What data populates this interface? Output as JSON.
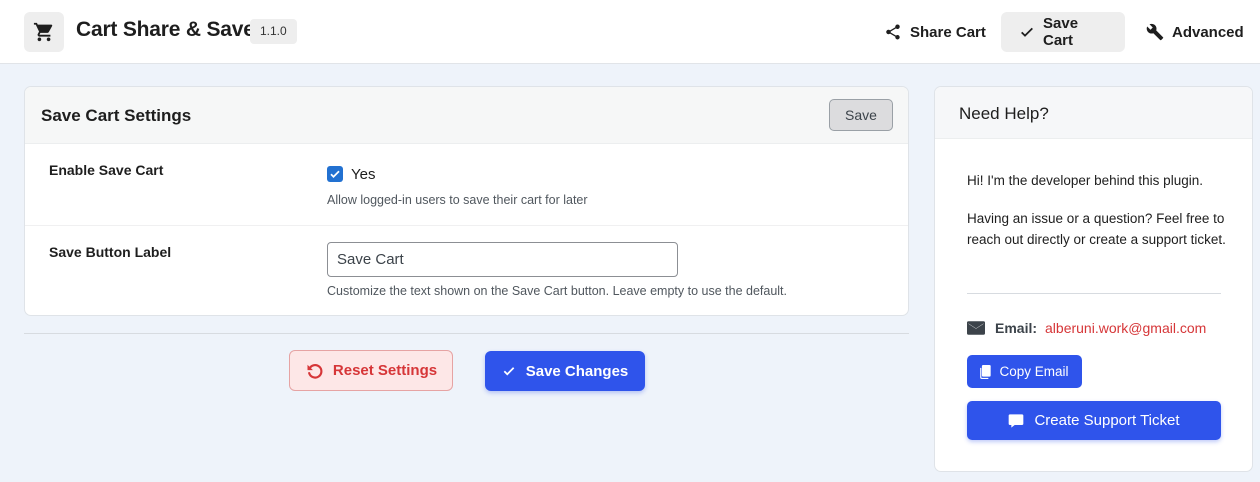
{
  "app": {
    "title": "Cart Share & Save",
    "version": "1.1.0"
  },
  "nav": {
    "share_label": "Share Cart",
    "save_label": "Save Cart",
    "advanced_label": "Advanced",
    "active": "Save Cart"
  },
  "settings": {
    "title": "Save Cart Settings",
    "save_button": "Save",
    "enable": {
      "label": "Enable Save Cart",
      "checked": true,
      "checkbox_label": "Yes",
      "description": "Allow logged-in users to save their cart for later"
    },
    "button_label": {
      "label": "Save Button Label",
      "value": "Save Cart",
      "description": "Customize the text shown on the Save Cart button. Leave empty to use the default."
    }
  },
  "actions": {
    "reset_label": "Reset Settings",
    "save_changes_label": "Save Changes"
  },
  "help": {
    "title": "Need Help?",
    "intro": "Hi! I'm the developer behind this plugin.",
    "body": "Having an issue or a question? Feel free to reach out directly or create a support ticket.",
    "email_label": "Email:",
    "email": "alberuni.work@gmail.com",
    "copy_label": "Copy Email",
    "ticket_label": "Create Support Ticket"
  },
  "colors": {
    "primary": "#2f54eb",
    "danger": "#d63638",
    "checkbox": "#2271d1",
    "background": "#eef3fa"
  }
}
